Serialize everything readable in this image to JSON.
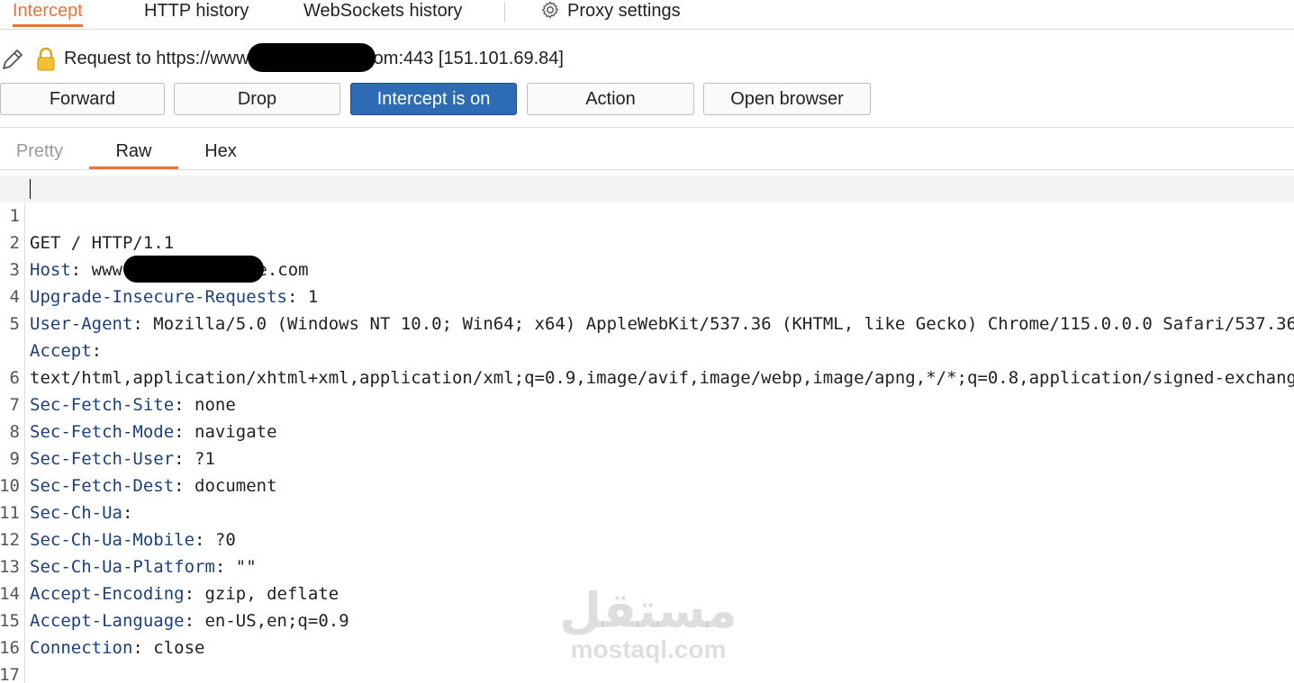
{
  "top_tabs": [
    {
      "label": "Intercept"
    },
    {
      "label": "HTTP history"
    },
    {
      "label": "WebSockets history"
    },
    {
      "label": "Proxy settings",
      "icon": "gear-icon"
    }
  ],
  "request": {
    "prefix": "Request to https://www",
    "suffix": "om:443 [151.101.69.84]"
  },
  "buttons": {
    "forward": "Forward",
    "drop": "Drop",
    "intercept": "Intercept is on",
    "action": "Action",
    "open_browser": "Open browser"
  },
  "editor_tabs": [
    {
      "label": "Pretty"
    },
    {
      "label": "Raw"
    },
    {
      "label": "Hex"
    }
  ],
  "lines": [
    {
      "n": "1",
      "key": "GET / HTTP/1.1",
      "sep": "",
      "val": ""
    },
    {
      "n": "2",
      "key": "Host",
      "sep": ": ",
      "val_a": "www.",
      "val_b": "e.com"
    },
    {
      "n": "3",
      "key": "Upgrade-Insecure-Requests",
      "sep": ": ",
      "val": "1"
    },
    {
      "n": "4",
      "key": "User-Agent",
      "sep": ": ",
      "val": "Mozilla/5.0 (Windows NT 10.0; Win64; x64) AppleWebKit/537.36 (KHTML, like Gecko) Chrome/115.0.0.0 Safari/537.36"
    },
    {
      "n": "5",
      "key": "Accept",
      "sep": ":",
      "val": ""
    },
    {
      "n": "",
      "key": "",
      "sep": "",
      "val": "text/html,application/xhtml+xml,application/xml;q=0.9,image/avif,image/webp,image/apng,*/*;q=0.8,application/signed-exchange;v=b3;q=0.7"
    },
    {
      "n": "6",
      "key": "Sec-Fetch-Site",
      "sep": ": ",
      "val": "none"
    },
    {
      "n": "7",
      "key": "Sec-Fetch-Mode",
      "sep": ": ",
      "val": "navigate"
    },
    {
      "n": "8",
      "key": "Sec-Fetch-User",
      "sep": ": ",
      "val": "?1"
    },
    {
      "n": "9",
      "key": "Sec-Fetch-Dest",
      "sep": ": ",
      "val": "document"
    },
    {
      "n": "10",
      "key": "Sec-Ch-Ua",
      "sep": ":",
      "val": ""
    },
    {
      "n": "11",
      "key": "Sec-Ch-Ua-Mobile",
      "sep": ": ",
      "val": "?0"
    },
    {
      "n": "12",
      "key": "Sec-Ch-Ua-Platform",
      "sep": ": ",
      "val": "\"\""
    },
    {
      "n": "13",
      "key": "Accept-Encoding",
      "sep": ": ",
      "val": "gzip, deflate"
    },
    {
      "n": "14",
      "key": "Accept-Language",
      "sep": ": ",
      "val": "en-US,en;q=0.9"
    },
    {
      "n": "15",
      "key": "Connection",
      "sep": ": ",
      "val": "close"
    },
    {
      "n": "16",
      "key": "",
      "sep": "",
      "val": ""
    },
    {
      "n": "17",
      "key": "",
      "sep": "",
      "val": ""
    }
  ],
  "watermark": {
    "arabic": "مستقل",
    "latin": "mostaql.com"
  },
  "colors": {
    "accent": "#e8743b",
    "intercept_on": "#2d6bb5",
    "header_key": "#1d3f7a"
  }
}
